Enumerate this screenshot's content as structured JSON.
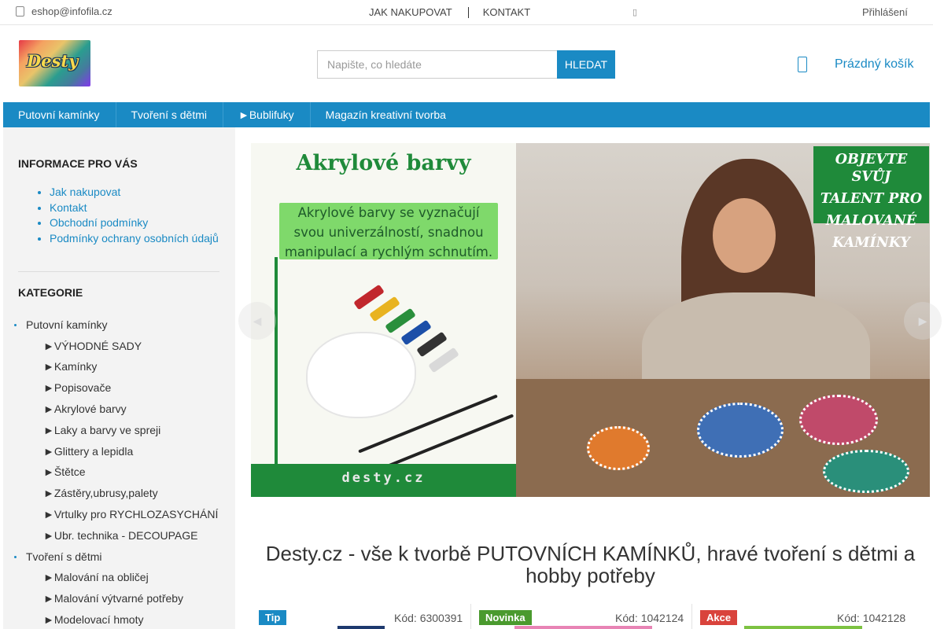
{
  "topbar": {
    "email": "eshop@infofila.cz",
    "links": [
      "JAK NAKUPOVAT",
      "KONTAKT"
    ],
    "login": "Přihlášení"
  },
  "header": {
    "logo_text": "Desty",
    "search_placeholder": "Napište, co hledáte",
    "search_button": "HLEDAT",
    "cart_label": "Prázdný košík"
  },
  "nav": {
    "items": [
      "Putovní kamínky",
      "Tvoření s dětmi",
      "►Bublifuky",
      "Magazín kreativní tvorba"
    ]
  },
  "sidebar": {
    "info_heading": "INFORMACE PRO VÁS",
    "info_links": [
      "Jak nakupovat",
      "Kontakt",
      "Obchodní podmínky",
      "Podmínky ochrany osobních údajů"
    ],
    "category_heading": "KATEGORIE",
    "categories": [
      {
        "label": "Putovní kamínky",
        "level": "main"
      },
      {
        "label": "►VÝHODNÉ SADY",
        "level": "sub"
      },
      {
        "label": "►Kamínky",
        "level": "sub"
      },
      {
        "label": "►Popisovače",
        "level": "sub"
      },
      {
        "label": "►Akrylové barvy",
        "level": "sub"
      },
      {
        "label": "►Laky a barvy ve spreji",
        "level": "sub"
      },
      {
        "label": "►Glittery a lepidla",
        "level": "sub"
      },
      {
        "label": "►Štětce",
        "level": "sub"
      },
      {
        "label": "►Zástěry,ubrusy,palety",
        "level": "sub"
      },
      {
        "label": "►Vrtulky pro RYCHLOZASYCHÁNÍ",
        "level": "sub"
      },
      {
        "label": "►Ubr. technika - DECOUPAGE",
        "level": "sub"
      },
      {
        "label": "Tvoření s dětmi",
        "level": "main"
      },
      {
        "label": "►Malování na obličej",
        "level": "sub"
      },
      {
        "label": "►Malování výtvarné potřeby",
        "level": "sub"
      },
      {
        "label": "►Modelovací hmoty",
        "level": "sub"
      }
    ]
  },
  "banner": {
    "left_title": "Akrylové barvy",
    "left_box": [
      "Akrylové barvy se vyznačují",
      "svou univerzálností, snadnou",
      "manipulací a rychlým schnutím."
    ],
    "left_footer": "desty.cz",
    "promo": [
      "OBJEVTE SVŮJ",
      "TALENT PRO",
      "MALOVANÉ",
      "KAMÍNKY"
    ]
  },
  "main": {
    "title": "Desty.cz - vše k tvorbě PUTOVNÍCH KAMÍNKŮ, hravé tvoření s dětmi a hobby potřeby"
  },
  "products": [
    {
      "badge": "Tip",
      "badge_color": "#1a8ac4",
      "code": "Kód: 6300391"
    },
    {
      "badge": "Novinka",
      "badge_color": "#4a9a2e",
      "code": "Kód: 1042124"
    },
    {
      "badge": "Akce",
      "badge_color": "#d9433c",
      "code": "Kód: 1042128"
    }
  ],
  "colors": {
    "accent": "#1a8ac4",
    "banner_green": "#1f8a3a"
  }
}
